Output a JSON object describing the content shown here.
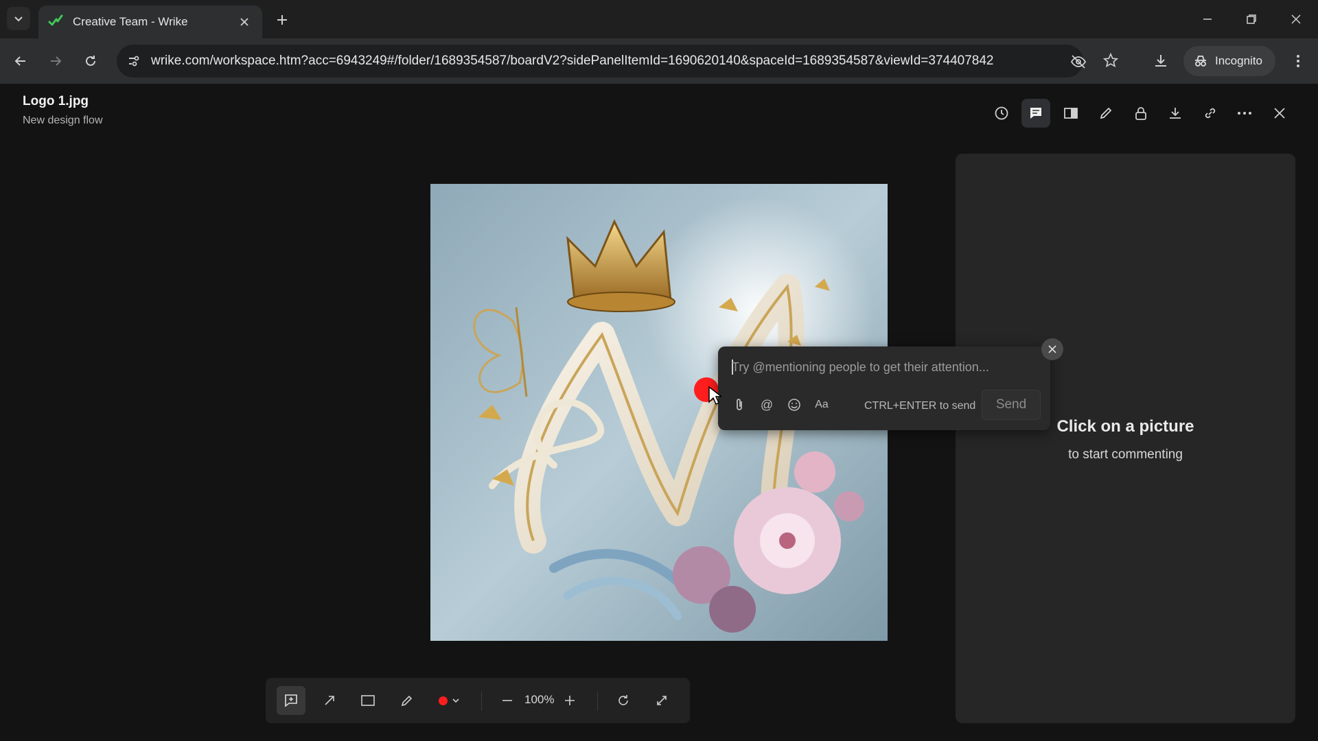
{
  "browser": {
    "tab_title": "Creative Team - Wrike",
    "url": "wrike.com/workspace.htm?acc=6943249#/folder/1689354587/boardV2?sidePanelItemId=1690620140&spaceId=1689354587&viewId=374407842",
    "incognito_label": "Incognito",
    "icons": [
      "tab-search-icon",
      "wrike-favicon",
      "close-icon",
      "plus-icon",
      "minimize-icon",
      "restore-icon",
      "close-window-icon",
      "back-icon",
      "forward-icon",
      "reload-icon",
      "site-info-icon",
      "eye-off-icon",
      "star-icon",
      "download-icon",
      "incognito-icon",
      "kebab-menu-icon"
    ]
  },
  "file": {
    "name": "Logo 1.jpg",
    "workflow": "New design flow"
  },
  "top_actions": [
    "history-icon",
    "comments-icon",
    "compare-icon",
    "edit-icon",
    "lock-icon",
    "download-icon",
    "link-icon",
    "more-icon",
    "close-icon"
  ],
  "comment_popup": {
    "placeholder": "Try @mentioning people to get their attention...",
    "hint": "CTRL+ENTER to send",
    "send_label": "Send",
    "tools": [
      "attach-icon",
      "mention-icon",
      "emoji-icon",
      "text-format-icon"
    ],
    "text_format_label": "Aa",
    "mention_symbol": "@"
  },
  "side_panel": {
    "empty_title": "Click on a picture",
    "empty_subtitle": "to start commenting"
  },
  "bottom_toolbar": {
    "zoom": "100%",
    "active_color": "#ff1e1e",
    "tools": [
      "add-comment-icon",
      "arrow-icon",
      "rectangle-icon",
      "pencil-icon",
      "color-picker",
      "zoom-out-icon",
      "zoom-in-icon",
      "rotate-icon",
      "fullscreen-icon"
    ]
  },
  "colors": {
    "accent_green": "#41c957",
    "marker_red": "#ff1e1e"
  }
}
